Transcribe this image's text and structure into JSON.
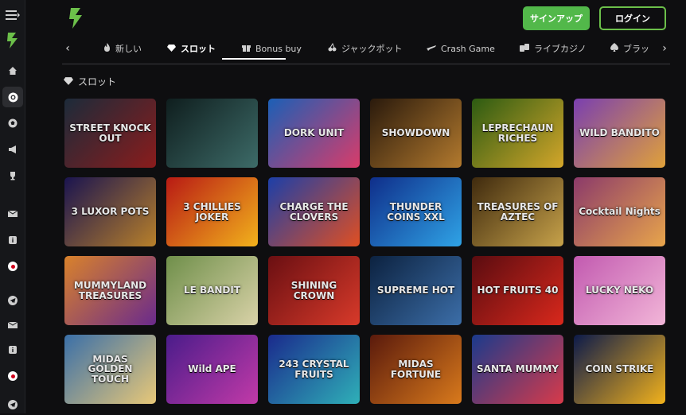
{
  "header": {
    "signup_label": "サインアップ",
    "login_label": "ログイン",
    "accent": "#52b84a"
  },
  "sidebar": {
    "items": [
      {
        "icon": "collapse-menu-icon"
      },
      {
        "icon": "brand-logo-icon"
      },
      {
        "icon": "home-icon"
      },
      {
        "icon": "casino-chip-icon"
      },
      {
        "icon": "sports-ball-icon"
      },
      {
        "icon": "megaphone-icon"
      },
      {
        "icon": "trophy-icon"
      },
      {
        "icon": "envelope-icon"
      },
      {
        "icon": "info-icon"
      },
      {
        "icon": "japan-flag-icon"
      },
      {
        "icon": "telegram-icon"
      },
      {
        "icon": "envelope-icon"
      },
      {
        "icon": "info-icon"
      },
      {
        "icon": "japan-flag-icon"
      },
      {
        "icon": "telegram-icon"
      }
    ]
  },
  "tabs": [
    {
      "label": "新しい",
      "icon": "flame-icon"
    },
    {
      "label": "スロット",
      "icon": "diamond-icon",
      "active": true
    },
    {
      "label": "Bonus buy",
      "icon": "gift-icon"
    },
    {
      "label": "ジャックポット",
      "icon": "cherries-icon"
    },
    {
      "label": "Crash Game",
      "icon": "plane-icon"
    },
    {
      "label": "ライブカジノ",
      "icon": "cards-icon"
    },
    {
      "label": "ブラッ",
      "icon": "spade-icon"
    }
  ],
  "section": {
    "title": "スロット"
  },
  "games": [
    {
      "title": "STREET KNOCK OUT",
      "colors": [
        "#1c2b3a",
        "#8a1c1c"
      ]
    },
    {
      "title": "",
      "colors": [
        "#0f1e1e",
        "#3d6b68"
      ]
    },
    {
      "title": "DORK UNIT",
      "colors": [
        "#1b5fb6",
        "#d93c6a"
      ]
    },
    {
      "title": "SHOWDOWN",
      "colors": [
        "#2a1a0c",
        "#b37a2e"
      ]
    },
    {
      "title": "LEPRECHAUN RICHES",
      "colors": [
        "#2c5b12",
        "#d4a62a"
      ]
    },
    {
      "title": "WILD BANDITO",
      "colors": [
        "#7a3fb0",
        "#e0a13a"
      ]
    },
    {
      "title": "3 LUXOR POTS",
      "colors": [
        "#1a1450",
        "#b8802a"
      ]
    },
    {
      "title": "3 CHILLIES JOKER",
      "colors": [
        "#b81a14",
        "#f2b21c"
      ]
    },
    {
      "title": "CHARGE THE CLOVERS",
      "colors": [
        "#1c3fa8",
        "#e04f22"
      ]
    },
    {
      "title": "THUNDER COINS XXL",
      "colors": [
        "#0f2e8a",
        "#2fa3e6"
      ]
    },
    {
      "title": "TREASURES OF AZTEC",
      "colors": [
        "#3f2a0e",
        "#c7a24a"
      ]
    },
    {
      "title": "Cocktail Nights",
      "colors": [
        "#8b3a6a",
        "#e8a54b"
      ]
    },
    {
      "title": "MUMMYLAND TREASURES",
      "colors": [
        "#d9822b",
        "#6a2a8c"
      ]
    },
    {
      "title": "LE BANDIT",
      "colors": [
        "#6f8f4a",
        "#d9d2a8"
      ]
    },
    {
      "title": "SHINING CROWN",
      "colors": [
        "#6a0f12",
        "#d83a2a"
      ]
    },
    {
      "title": "SUPREME HOT",
      "colors": [
        "#0c2240",
        "#3c6ea8"
      ]
    },
    {
      "title": "HOT FRUITS 40",
      "colors": [
        "#5a0c10",
        "#d9281c"
      ]
    },
    {
      "title": "LUCKY NEKO",
      "colors": [
        "#c25ab0",
        "#f2b6d8"
      ]
    },
    {
      "title": "MIDAS GOLDEN TOUCH",
      "colors": [
        "#3a6fa8",
        "#e8c878"
      ]
    },
    {
      "title": "Wild APE",
      "colors": [
        "#4a1c8a",
        "#c23aa8"
      ]
    },
    {
      "title": "243 CRYSTAL FRUITS",
      "colors": [
        "#1a2a8c",
        "#2fb0b8"
      ]
    },
    {
      "title": "MIDAS FORTUNE",
      "colors": [
        "#5a1a0c",
        "#d97a1c"
      ]
    },
    {
      "title": "SANTA MUMMY",
      "colors": [
        "#1a3a8c",
        "#d83a4a"
      ]
    },
    {
      "title": "COIN STRIKE",
      "colors": [
        "#0c1a4a",
        "#f2b21c"
      ]
    }
  ]
}
